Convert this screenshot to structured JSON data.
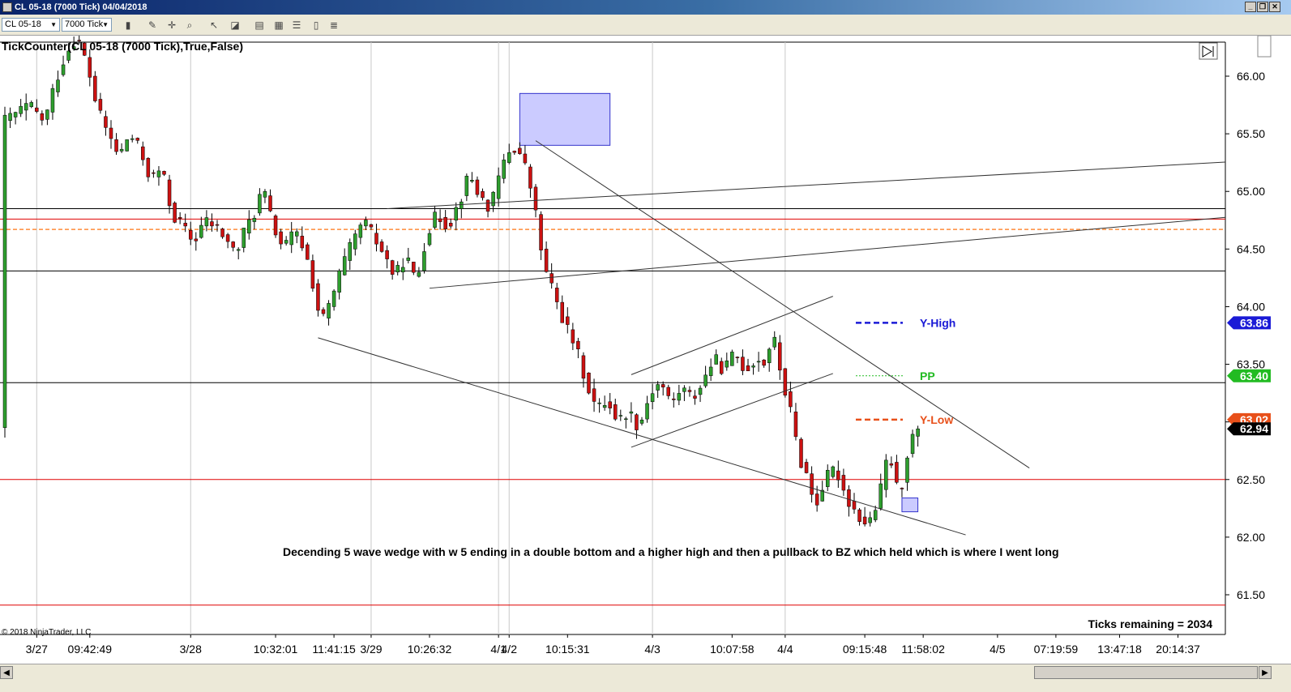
{
  "window": {
    "title": "CL 05-18 (7000 Tick)  04/04/2018",
    "buttons": [
      "_",
      "❐",
      "✕"
    ]
  },
  "toolbar": {
    "instrument": "CL 05-18",
    "interval": "7000 Tick"
  },
  "indicator_label": "TickCounter(CL 05-18 (7000 Tick),True,False)",
  "copyright": "© 2018 NinjaTrader, LLC",
  "ticks_remaining": "Ticks remaining = 2034",
  "annotation": "Decending 5 wave wedge with w 5 ending in a double bottom and a higher high and then a pullback to BZ which held which is where I went long",
  "colors": {
    "up_candle": "#2e9e2e",
    "down_candle": "#cc1111",
    "wick": "#000000",
    "red_line": "#e00000",
    "orange_dash": "#ff8c3a",
    "zone_fill": "#b9b9ff",
    "zone_stroke": "#3333cc"
  },
  "chart_data": {
    "type": "candlestick",
    "y_axis": {
      "min": 61.3,
      "max": 66.3,
      "ticks": [
        61.5,
        62.0,
        62.5,
        63.0,
        63.5,
        64.0,
        64.5,
        65.0,
        65.5,
        66.0
      ],
      "tick_labels": [
        "61.50",
        "62.00",
        "62.50",
        "63.00",
        "63.50",
        "64.00",
        "64.50",
        "65.00",
        "65.50",
        "66.00"
      ]
    },
    "x_axis": {
      "count": 226,
      "labels": [
        {
          "i": 6,
          "text": "3/27"
        },
        {
          "i": 16,
          "text": "09:42:49"
        },
        {
          "i": 35,
          "text": "3/28"
        },
        {
          "i": 51,
          "text": "10:32:01"
        },
        {
          "i": 62,
          "text": "11:41:15"
        },
        {
          "i": 69,
          "text": "3/29"
        },
        {
          "i": 80,
          "text": "10:26:32"
        },
        {
          "i": 93,
          "text": "4/1"
        },
        {
          "i": 95,
          "text": "4/2"
        },
        {
          "i": 106,
          "text": "10:15:31"
        },
        {
          "i": 122,
          "text": "4/3"
        },
        {
          "i": 137,
          "text": "10:07:58"
        },
        {
          "i": 147,
          "text": "4/4"
        },
        {
          "i": 162,
          "text": "09:15:48"
        },
        {
          "i": 173,
          "text": "11:58:02"
        },
        {
          "i": 187,
          "text": "4/5"
        },
        {
          "i": 198,
          "text": "07:19:59"
        },
        {
          "i": 210,
          "text": "13:47:18"
        },
        {
          "i": 221,
          "text": "20:14:37"
        }
      ]
    },
    "session_separators": [
      6,
      35,
      69,
      93,
      95,
      122,
      147
    ],
    "price_points": [
      [
        0,
        65.6
      ],
      [
        5,
        65.75
      ],
      [
        8,
        65.6
      ],
      [
        10,
        65.95
      ],
      [
        12,
        66.2
      ],
      [
        14,
        66.35
      ],
      [
        16,
        66.1
      ],
      [
        18,
        65.7
      ],
      [
        20,
        65.5
      ],
      [
        22,
        65.3
      ],
      [
        24,
        65.5
      ],
      [
        26,
        65.35
      ],
      [
        28,
        65.1
      ],
      [
        30,
        65.2
      ],
      [
        32,
        64.8
      ],
      [
        34,
        64.7
      ],
      [
        36,
        64.55
      ],
      [
        38,
        64.75
      ],
      [
        40,
        64.7
      ],
      [
        42,
        64.6
      ],
      [
        44,
        64.45
      ],
      [
        46,
        64.7
      ],
      [
        48,
        64.85
      ],
      [
        49,
        65.05
      ],
      [
        51,
        64.7
      ],
      [
        53,
        64.5
      ],
      [
        55,
        64.65
      ],
      [
        57,
        64.5
      ],
      [
        59,
        64.1
      ],
      [
        60,
        63.85
      ],
      [
        62,
        64.05
      ],
      [
        64,
        64.35
      ],
      [
        66,
        64.55
      ],
      [
        68,
        64.75
      ],
      [
        70,
        64.6
      ],
      [
        72,
        64.45
      ],
      [
        74,
        64.25
      ],
      [
        76,
        64.45
      ],
      [
        78,
        64.2
      ],
      [
        80,
        64.65
      ],
      [
        82,
        64.8
      ],
      [
        84,
        64.7
      ],
      [
        86,
        64.9
      ],
      [
        88,
        65.15
      ],
      [
        90,
        64.95
      ],
      [
        92,
        64.85
      ],
      [
        94,
        65.2
      ],
      [
        96,
        65.4
      ],
      [
        98,
        65.3
      ],
      [
        100,
        64.95
      ],
      [
        102,
        64.35
      ],
      [
        104,
        64.1
      ],
      [
        106,
        63.85
      ],
      [
        108,
        63.65
      ],
      [
        110,
        63.35
      ],
      [
        112,
        63.1
      ],
      [
        114,
        63.2
      ],
      [
        116,
        63.0
      ],
      [
        118,
        63.1
      ],
      [
        120,
        62.95
      ],
      [
        122,
        63.25
      ],
      [
        124,
        63.35
      ],
      [
        126,
        63.15
      ],
      [
        128,
        63.3
      ],
      [
        130,
        63.2
      ],
      [
        132,
        63.35
      ],
      [
        134,
        63.55
      ],
      [
        136,
        63.45
      ],
      [
        138,
        63.6
      ],
      [
        140,
        63.45
      ],
      [
        142,
        63.55
      ],
      [
        144,
        63.5
      ],
      [
        145,
        63.8
      ],
      [
        147,
        63.35
      ],
      [
        149,
        63.0
      ],
      [
        150,
        62.7
      ],
      [
        152,
        62.5
      ],
      [
        153,
        62.25
      ],
      [
        155,
        62.5
      ],
      [
        157,
        62.6
      ],
      [
        159,
        62.35
      ],
      [
        161,
        62.2
      ],
      [
        163,
        62.1
      ],
      [
        165,
        62.3
      ],
      [
        167,
        62.75
      ],
      [
        168,
        62.55
      ],
      [
        169,
        62.3
      ],
      [
        170,
        62.65
      ],
      [
        172,
        62.95
      ]
    ],
    "horizontal_lines": [
      {
        "price": 64.85,
        "color": "#000000",
        "style": "solid"
      },
      {
        "price": 64.31,
        "color": "#000000",
        "style": "solid"
      },
      {
        "price": 63.34,
        "color": "#000000",
        "style": "solid"
      },
      {
        "price": 64.76,
        "color": "#e00000",
        "style": "solid"
      },
      {
        "price": 64.67,
        "color": "#ff8c3a",
        "style": "dashed"
      },
      {
        "price": 62.5,
        "color": "#e00000",
        "style": "solid"
      },
      {
        "price": 61.41,
        "color": "#e00000",
        "style": "solid"
      }
    ],
    "trend_lines": [
      {
        "from": [
          59,
          63.73
        ],
        "to": [
          181,
          62.02
        ]
      },
      {
        "from": [
          100,
          65.44
        ],
        "to": [
          193,
          62.6
        ]
      },
      {
        "from": [
          118,
          62.78
        ],
        "to": [
          156,
          63.42
        ]
      },
      {
        "from": [
          118,
          63.41
        ],
        "to": [
          156,
          64.09
        ]
      },
      {
        "from": [
          72,
          64.85
        ],
        "to": [
          236,
          65.27
        ]
      },
      {
        "from": [
          80,
          64.16
        ],
        "to": [
          236,
          64.8
        ]
      }
    ],
    "zones": [
      {
        "from_i": 97,
        "to_i": 114,
        "top": 65.85,
        "bottom": 65.4
      },
      {
        "from_i": 169,
        "to_i": 172,
        "top": 62.34,
        "bottom": 62.22
      }
    ],
    "levels": [
      {
        "name": "Y-High",
        "price": 63.86,
        "label": "63.86",
        "color": "#1a1ad6",
        "badge_color": "#1a1ad6"
      },
      {
        "name": "PP",
        "price": 63.4,
        "label": "63.40",
        "color": "#22bb22",
        "badge_color": "#22bb22"
      },
      {
        "name": "Y-Low",
        "price": 63.02,
        "label": "63.02",
        "color": "#e8501a",
        "badge_color": "#e8501a"
      }
    ],
    "last_price": {
      "price": 62.94,
      "label": "62.94"
    }
  }
}
